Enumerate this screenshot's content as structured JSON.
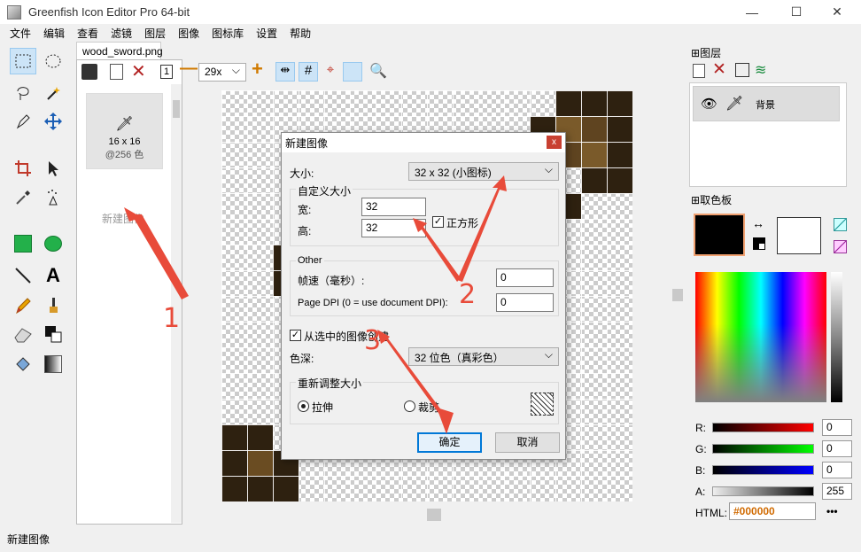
{
  "window": {
    "title": "Greenfish Icon Editor Pro 64-bit",
    "minimize": "—",
    "maximize": "☐",
    "close": "✕"
  },
  "menu": [
    "文件",
    "编辑",
    "查看",
    "滤镜",
    "图层",
    "图像",
    "图标库",
    "设置",
    "帮助"
  ],
  "document_tab": "wood_sword.png",
  "thumbnail": {
    "size": "16 x 16",
    "depth": "@256 色",
    "new_image_label": "新建图像"
  },
  "editor_toolbar": {
    "zoom": "29x",
    "minus": "—",
    "plus": "+"
  },
  "dialog": {
    "title": "新建图像",
    "size_label": "大小:",
    "size_value": "32 x 32 (小图标)",
    "custom_group": "自定义大小",
    "width_label": "宽:",
    "width_value": "32",
    "height_label": "高:",
    "height_value": "32",
    "square_label": "正方形",
    "square_checked": true,
    "other_group": "Other",
    "frame_rate_label": "帧速（毫秒）:",
    "frame_rate_value": "0",
    "dpi_label": "Page DPI (0 = use document DPI):",
    "dpi_value": "0",
    "from_selection_label": "从选中的图像创建",
    "from_selection_checked": true,
    "depth_label": "色深:",
    "depth_value": "32 位色（真彩色）",
    "resize_group": "重新调整大小",
    "stretch_label": "拉伸",
    "crop_label": "裁剪",
    "ok_label": "确定",
    "cancel_label": "取消"
  },
  "layers": {
    "header": "图层",
    "layer_name": "背景"
  },
  "color_picker": {
    "header": "取色板",
    "primary_color": "#000000",
    "secondary_color": "#ffffff",
    "r_label": "R:",
    "r_value": "0",
    "g_label": "G:",
    "g_value": "0",
    "b_label": "B:",
    "b_value": "0",
    "a_label": "A:",
    "a_value": "255",
    "html_label": "HTML:",
    "html_value": "#000000",
    "more": "•••"
  },
  "status": "新建图像",
  "annotations": {
    "one": "1",
    "two": "2",
    "three": "3",
    "color": "#e84b3a"
  }
}
